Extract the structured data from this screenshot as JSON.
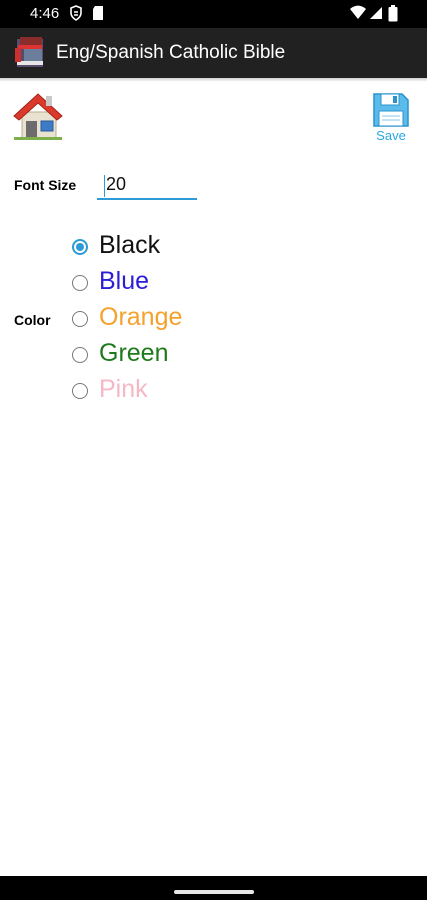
{
  "status_bar": {
    "time": "4:46"
  },
  "app_bar": {
    "title": "Eng/Spanish Catholic Bible"
  },
  "toolbar": {
    "save_label": "Save"
  },
  "settings": {
    "font_size_label": "Font Size",
    "font_size_value": "20",
    "color_label": "Color",
    "color_options": [
      {
        "label": "Black",
        "color": "#111111",
        "selected": true
      },
      {
        "label": "Blue",
        "color": "#2b1cd6",
        "selected": false
      },
      {
        "label": "Orange",
        "color": "#f5a12b",
        "selected": false
      },
      {
        "label": "Green",
        "color": "#1e7a1a",
        "selected": false
      },
      {
        "label": "Pink",
        "color": "#f6b7c6",
        "selected": false
      }
    ]
  }
}
